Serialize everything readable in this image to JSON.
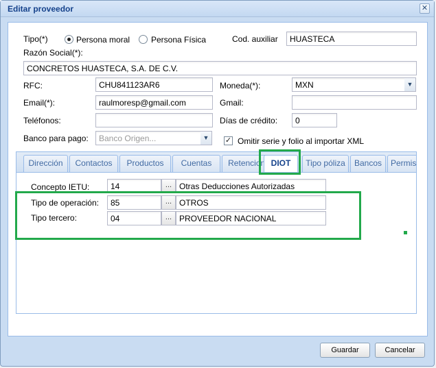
{
  "window": {
    "title": "Editar proveedor",
    "close_glyph": "✕"
  },
  "form": {
    "tipo_label": "Tipo(*)",
    "tipo_options": [
      {
        "label": "Persona moral",
        "checked": true
      },
      {
        "label": "Persona Física",
        "checked": false
      }
    ],
    "cod_auxiliar_label": "Cod. auxiliar",
    "cod_auxiliar_value": "HUASTECA",
    "razon_social_label": "Razón Social(*):",
    "razon_social_value": "CONCRETOS HUASTECA, S.A. DE C.V.",
    "rfc_label": "RFC:",
    "rfc_value": "CHU841123AR6",
    "moneda_label": "Moneda(*):",
    "moneda_value": "MXN",
    "email_label": "Email(*):",
    "email_value": "raulmoresp@gmail.com",
    "gmail_label": "Gmail:",
    "gmail_value": "",
    "telefonos_label": "Teléfonos:",
    "telefonos_value": "",
    "dias_credito_label": "Días de crédito:",
    "dias_credito_value": "0",
    "banco_label": "Banco para pago:",
    "banco_placeholder": "Banco Origen...",
    "omitir_label": "Omitir serie y folio al importar XML",
    "omitir_checked": true
  },
  "tabs": [
    {
      "label": "Dirección",
      "active": false
    },
    {
      "label": "Contactos",
      "active": false
    },
    {
      "label": "Productos",
      "active": false
    },
    {
      "label": "Cuentas",
      "active": false
    },
    {
      "label": "Retenciones",
      "active": false
    },
    {
      "label": "DIOT",
      "active": true
    },
    {
      "label": "Tipo póliza",
      "active": false
    },
    {
      "label": "Bancos",
      "active": false
    },
    {
      "label": "Permisos",
      "active": false
    }
  ],
  "diot": {
    "rows": [
      {
        "label": "Concepto IETU:",
        "code": "14",
        "desc": "Otras Deducciones Autorizadas"
      },
      {
        "label": "Tipo de operación:",
        "code": "85",
        "desc": "OTROS"
      },
      {
        "label": "Tipo tercero:",
        "code": "04",
        "desc": "PROVEEDOR NACIONAL"
      }
    ],
    "dots_label": "..."
  },
  "buttons": {
    "save": "Guardar",
    "cancel": "Cancelar"
  },
  "icons": {
    "dropdown": "chevron-down-icon",
    "check": "check-icon"
  },
  "colors": {
    "highlight": "#22a94b",
    "title": "#15428b",
    "tab_text": "#416aa3"
  }
}
